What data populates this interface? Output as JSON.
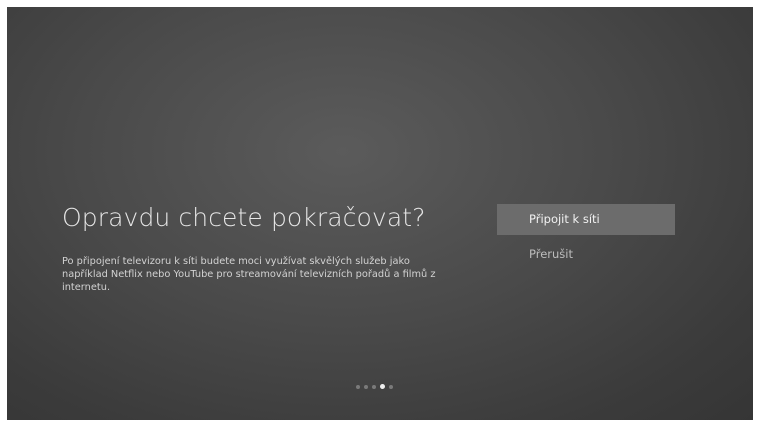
{
  "dialog": {
    "title": "Opravdu chcete pokračovat?",
    "description": "Po připojení televizoru k síti budete moci využívat skvělých služeb jako například Netflix nebo YouTube pro streamování televizních pořadů a filmů z internetu."
  },
  "options": [
    {
      "label": "Připojit k síti",
      "selected": true
    },
    {
      "label": "Přerušit",
      "selected": false
    }
  ],
  "pagination": {
    "total": 5,
    "current": 4
  },
  "colors": {
    "background": "#4a4a4a",
    "selected_option_bg": "#6c6c6c",
    "text": "#e6e6e6"
  }
}
